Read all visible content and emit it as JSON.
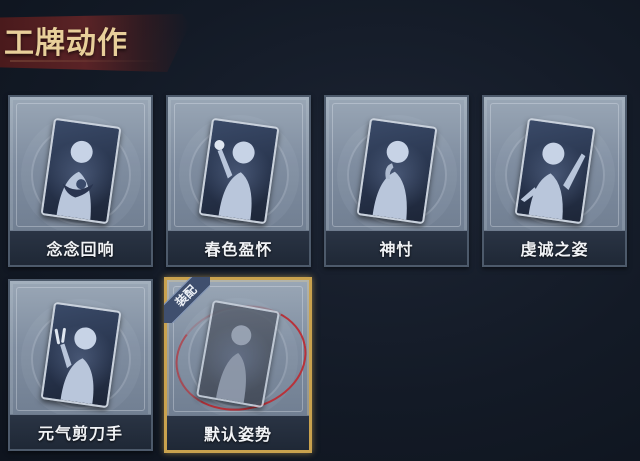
{
  "header": {
    "title": "工牌动作"
  },
  "cards": [
    {
      "label": "念念回响",
      "icon": "hug-pose-icon",
      "equipped": false
    },
    {
      "label": "春色盈怀",
      "icon": "flower-pose-icon",
      "equipped": false
    },
    {
      "label": "神忖",
      "icon": "thinking-pose-icon",
      "equipped": false
    },
    {
      "label": "虔诚之姿",
      "icon": "raised-hand-pose-icon",
      "equipped": false
    },
    {
      "label": "元气剪刀手",
      "icon": "peace-sign-pose-icon",
      "equipped": false
    },
    {
      "label": "默认姿势",
      "icon": "default-pose-icon",
      "equipped": true,
      "equip_tag": "装配"
    }
  ],
  "colors": {
    "title": "#e8cf9a",
    "equipped_border": "#c9a24e",
    "equip_ring": "#b8323a"
  }
}
